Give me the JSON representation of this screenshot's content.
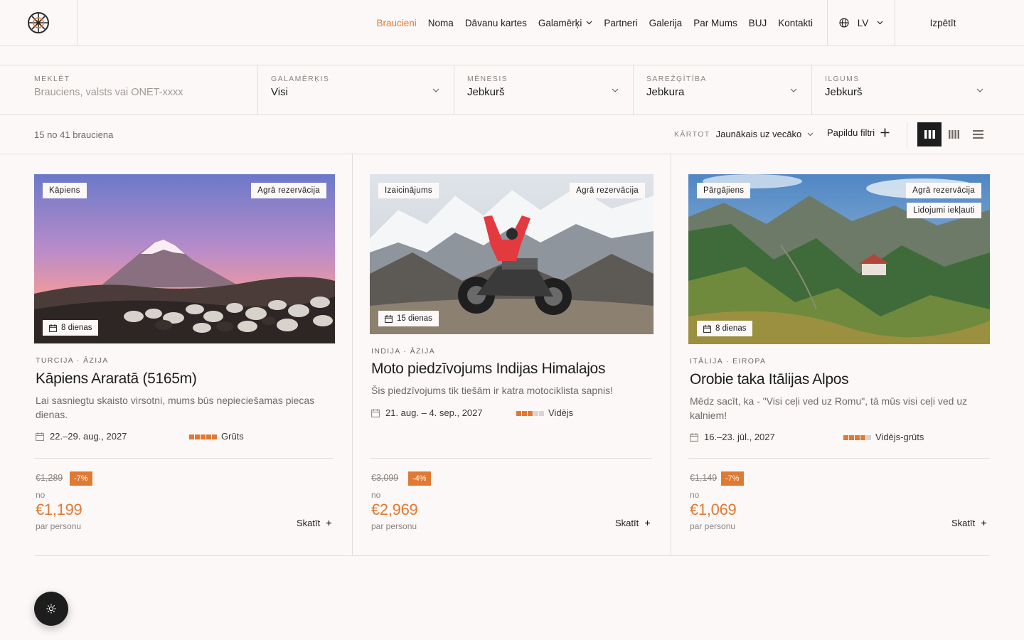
{
  "header": {
    "nav": [
      {
        "label": "Braucieni",
        "active": true
      },
      {
        "label": "Noma"
      },
      {
        "label": "Dāvanu kartes"
      },
      {
        "label": "Galamērķi",
        "dropdown": true
      },
      {
        "label": "Partneri"
      },
      {
        "label": "Galerija"
      },
      {
        "label": "Par Mums"
      },
      {
        "label": "BUJ"
      },
      {
        "label": "Kontakti"
      }
    ],
    "language": "LV",
    "explore_label": "Izpētīt"
  },
  "filters": {
    "search": {
      "label": "MEKLĒT",
      "placeholder": "Brauciens, valsts vai ONET-xxxx"
    },
    "destination": {
      "label": "GALAMĒRĶIS",
      "value": "Visi"
    },
    "month": {
      "label": "MĒNESIS",
      "value": "Jebkurš"
    },
    "difficulty": {
      "label": "SAREŽĢĪTĪBA",
      "value": "Jebkura"
    },
    "duration": {
      "label": "ILGUMS",
      "value": "Jebkurš"
    }
  },
  "toolbar": {
    "count": "15 no 41 brauciena",
    "sort_label": "KĀRTOT",
    "sort_value": "Jaunākais uz vecāko",
    "more_filters": "Papildu filtri"
  },
  "trips": [
    {
      "category": "Kāpiens",
      "badges": [
        "Agrā rezervācija"
      ],
      "days": "8 dienas",
      "region": "TURCIJA · ĀZIJA",
      "title": "Kāpiens Araratā (5165m)",
      "description": "Lai sasniegtu skaisto virsotni, mums būs nepieciešamas piecas dienas.",
      "dates": "22.–29. aug., 2027",
      "difficulty_level": 5,
      "difficulty_label": "Grūts",
      "old_price": "€1,289",
      "discount": "-7%",
      "from_label": "no",
      "price": "€1,199",
      "per_label": "par personu",
      "view_label": "Skatīt"
    },
    {
      "category": "Izaicinājums",
      "badges": [
        "Agrā rezervācija"
      ],
      "days": "15 dienas",
      "region": "INDIJA · ĀZIJA",
      "title": "Moto piedzīvojums Indijas Himalajos",
      "description": "Šis piedzīvojums tik tiešām ir katra motociklista sapnis!",
      "dates": "21. aug. – 4. sep., 2027",
      "difficulty_level": 3,
      "difficulty_label": "Vidējs",
      "old_price": "€3,099",
      "discount": "-4%",
      "from_label": "no",
      "price": "€2,969",
      "per_label": "par personu",
      "view_label": "Skatīt"
    },
    {
      "category": "Pārgājiens",
      "badges": [
        "Agrā rezervācija",
        "Lidojumi iekļauti"
      ],
      "days": "8 dienas",
      "region": "ITĀLIJA · EIROPA",
      "title": "Orobie taka Itālijas Alpos",
      "description": "Mēdz sacīt, ka - \"Visi ceļi ved uz Romu\", tā mūs visi ceļi ved uz kalniem!",
      "dates": "16.–23. jūl., 2027",
      "difficulty_level": 4,
      "difficulty_label": "Vidējs-grūts",
      "old_price": "€1,149",
      "discount": "-7%",
      "from_label": "no",
      "price": "€1,069",
      "per_label": "par personu",
      "view_label": "Skatīt"
    }
  ],
  "colors": {
    "accent": "#e07a33",
    "background": "#fcf8f7",
    "dark": "#1d1d1d",
    "muted": "#d9d4d1"
  }
}
